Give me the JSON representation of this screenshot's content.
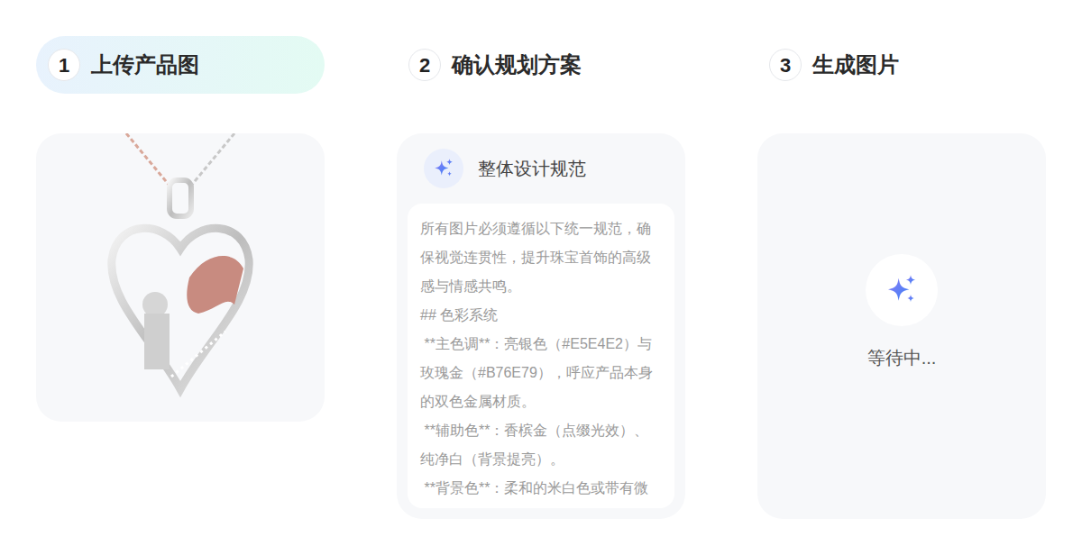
{
  "steps": [
    {
      "number": "1",
      "label": "上传产品图",
      "selected": true
    },
    {
      "number": "2",
      "label": "确认规划方案",
      "selected": false
    },
    {
      "number": "3",
      "label": "生成图片",
      "selected": false
    }
  ],
  "plan": {
    "title": "整体设计规范",
    "paragraphs": [
      "所有图片必须遵循以下统一规范，确保视觉连贯性，提升珠宝首饰的高级感与情感共鸣。",
      "## 色彩系统",
      " **主色调**：亮银色（#E5E4E2）与玫瑰金（#B76E79），呼应产品本身的双色金属材质。",
      " **辅助色**：香槟金（点缀光效）、纯净白（背景提亮）。",
      " **背景色**：柔和的米白色或带有微"
    ]
  },
  "result": {
    "status": "等待中..."
  }
}
